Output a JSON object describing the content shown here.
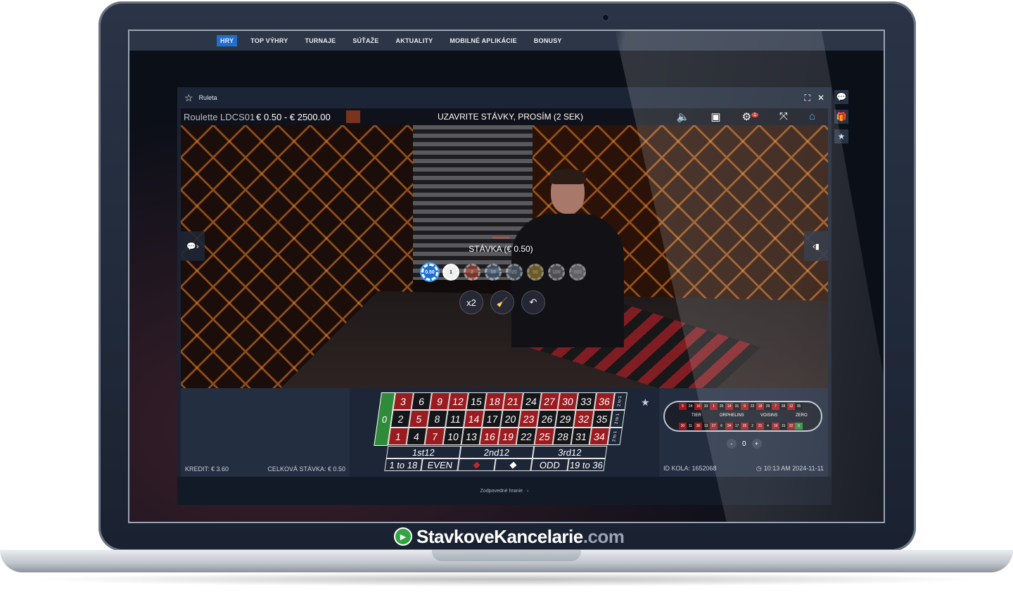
{
  "site_nav": [
    "HRY",
    "TOP VÝHRY",
    "TURNAJE",
    "SÚŤAŽE",
    "AKTUALITY",
    "MOBILNÉ APLIKÁCIE",
    "BONUSY"
  ],
  "game_window": {
    "title": "Ruleta"
  },
  "video_bar": {
    "table_name": "Roulette LDCS01",
    "limits": "€ 0.50 - € 2500.00",
    "message": "UZAVRITE STÁVKY, PROSÍM (2 SEK)",
    "settings_badge": "1"
  },
  "bet_panel": {
    "label": "STÁVKA (€ 0.50)",
    "chips": [
      {
        "label": "0.50",
        "color": "#1e6fd0"
      },
      {
        "label": "1",
        "color": "#f0f0f0"
      },
      {
        "label": "2",
        "color": "#d64b33"
      },
      {
        "label": "10",
        "color": "#5a7fa6"
      },
      {
        "label": "20",
        "color": "#6d8a9e"
      },
      {
        "label": "50",
        "color": "#c9a227"
      },
      {
        "label": "100",
        "color": "#8c8c8c"
      },
      {
        "label": "500",
        "color": "#b0b0b0"
      }
    ],
    "double_label": "x2"
  },
  "board": {
    "zero": "0",
    "rows": [
      [
        "3",
        "6",
        "9",
        "12",
        "15",
        "18",
        "21",
        "24",
        "27",
        "30",
        "33",
        "36"
      ],
      [
        "2",
        "5",
        "8",
        "11",
        "14",
        "17",
        "20",
        "23",
        "26",
        "29",
        "32",
        "35"
      ],
      [
        "1",
        "4",
        "7",
        "10",
        "13",
        "16",
        "19",
        "22",
        "25",
        "28",
        "31",
        "34"
      ]
    ],
    "red": [
      "1",
      "3",
      "5",
      "7",
      "9",
      "12",
      "14",
      "16",
      "18",
      "19",
      "21",
      "23",
      "25",
      "27",
      "30",
      "32",
      "34",
      "36"
    ],
    "columns": [
      "2 to 1",
      "2 to 1",
      "2 to 1"
    ],
    "dozens": [
      "1st12",
      "2nd12",
      "3rd12"
    ],
    "outside": [
      "1 to 18",
      "EVEN",
      "",
      "",
      "ODD",
      "19 to 36"
    ]
  },
  "racetrack": {
    "top": [
      "5",
      "24",
      "16",
      "33",
      "1",
      "20",
      "14",
      "31",
      "9",
      "22",
      "18",
      "29",
      "7",
      "28",
      "12",
      "35"
    ],
    "bottom": [
      "30",
      "11",
      "36",
      "13",
      "27",
      "6",
      "34",
      "17",
      "25",
      "2",
      "21",
      "4",
      "19",
      "15",
      "32",
      "0"
    ],
    "sections": [
      "TIER",
      "ORPHELINS",
      "VOISINS",
      "ZERO"
    ],
    "neighbours_minus": "-",
    "neighbours_value": "0",
    "neighbours_plus": "+"
  },
  "info_left": {
    "credit": "KREDIT: € 3.60",
    "total_bet": "CELKOVÁ STÁVKA: € 0.50"
  },
  "info_right": {
    "round_id": "ID KOLA: 1652068",
    "time": "10:13 AM 2024-11-11"
  },
  "footer": {
    "link": "Zodpovedné hranie"
  },
  "brand": {
    "name_main": "StavkoveKancelarie",
    "name_tld": ".com"
  }
}
